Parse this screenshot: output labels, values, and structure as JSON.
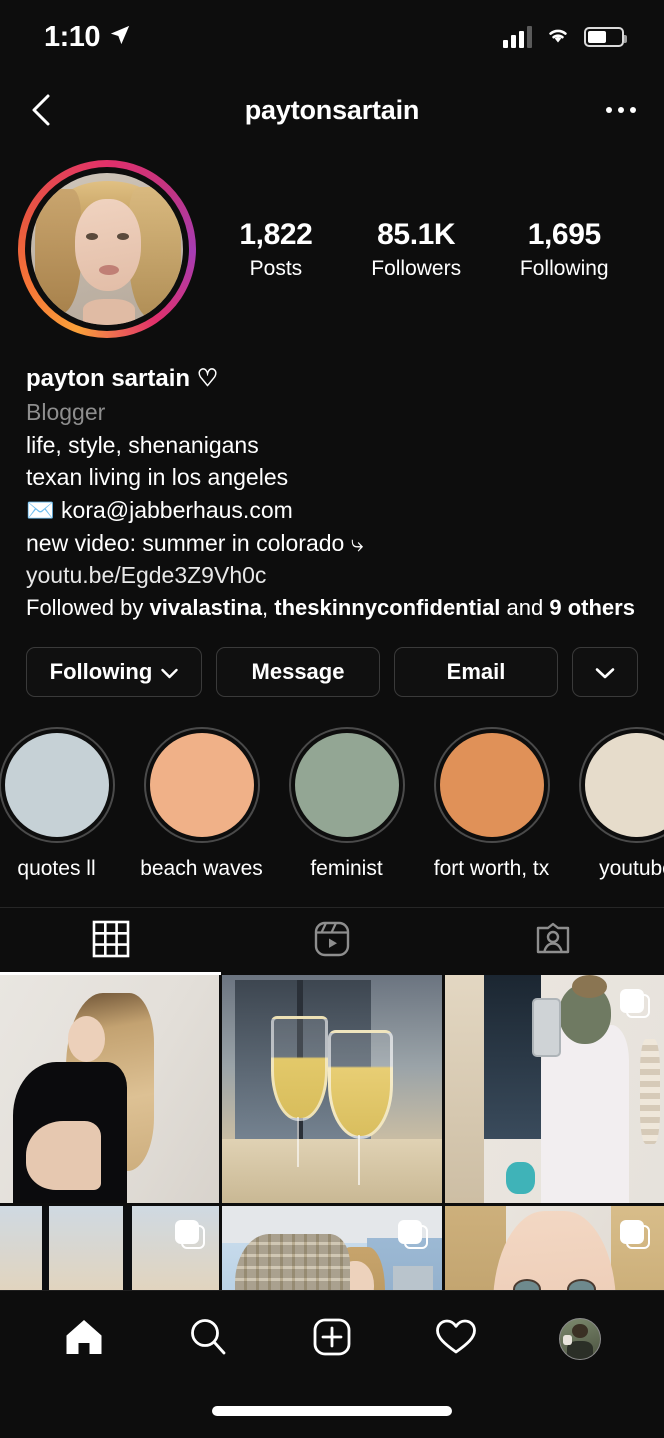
{
  "status_bar": {
    "time": "1:10",
    "location_icon": "location-arrow-icon",
    "cellular_icon": "cellular-bars-icon",
    "wifi_icon": "wifi-icon",
    "battery_icon": "battery-icon",
    "battery_level_percent": 55
  },
  "header": {
    "back_icon": "back-chevron-icon",
    "username": "paytonsartain",
    "more_icon": "ellipsis-icon"
  },
  "profile": {
    "avatar_has_story_ring": true,
    "story_ring_colors": [
      "#f9a03a",
      "#e1306c",
      "#c13584"
    ],
    "stats": [
      {
        "number": "1,822",
        "label": "Posts"
      },
      {
        "number": "85.1K",
        "label": "Followers"
      },
      {
        "number": "1,695",
        "label": "Following"
      }
    ],
    "display_name": "payton sartain ♡",
    "category": "Blogger",
    "bio_lines": [
      "life, style, shenanigans",
      "texan living in los angeles"
    ],
    "email_line": "✉️  kora@jabberhaus.com",
    "video_line": "new video: summer in colorado ⤷",
    "link": "youtu.be/Egde3Z9Vh0c",
    "followed_by_prefix": "Followed by ",
    "followed_by_names": [
      "vivalastina",
      "theskinnyconfidential"
    ],
    "followed_by_suffix_prefix": " and ",
    "followed_by_count": "9 others"
  },
  "actions": {
    "following_label": "Following",
    "following_chevron": "chevron-down-icon",
    "message_label": "Message",
    "email_label": "Email",
    "more_chevron": "chevron-down-icon"
  },
  "highlights": [
    {
      "label": "quotes ll",
      "color": "#c6d1d6"
    },
    {
      "label": "beach waves",
      "color": "#f0b188"
    },
    {
      "label": "feminist",
      "color": "#93a694"
    },
    {
      "label": "fort worth, tx",
      "color": "#e09158"
    },
    {
      "label": "youtube",
      "color": "#e6dccb"
    }
  ],
  "tabs": [
    {
      "name": "grid-tab",
      "icon": "grid-icon",
      "active": true
    },
    {
      "name": "reels-tab",
      "icon": "reels-icon",
      "active": false
    },
    {
      "name": "tagged-tab",
      "icon": "tagged-person-icon",
      "active": false
    }
  ],
  "grid_posts": [
    {
      "alt": "woman in black dress against cream wall",
      "carousel": false
    },
    {
      "alt": "two glasses of white wine on windowsill",
      "carousel": false
    },
    {
      "alt": "mirror selfie with green face mask",
      "carousel": true
    },
    {
      "alt": "sunset city view through window",
      "carousel": true
    },
    {
      "alt": "woman in plaid jacket by window",
      "carousel": true
    },
    {
      "alt": "close-up portrait of blonde woman",
      "carousel": true
    }
  ],
  "bottom_nav": [
    {
      "name": "home-nav-item",
      "icon": "home-icon",
      "active": true
    },
    {
      "name": "search-nav-item",
      "icon": "search-icon",
      "active": false
    },
    {
      "name": "create-nav-item",
      "icon": "plus-square-icon",
      "active": false
    },
    {
      "name": "activity-nav-item",
      "icon": "heart-icon",
      "active": false
    },
    {
      "name": "profile-nav-item",
      "icon": "profile-avatar-icon",
      "active": false
    }
  ]
}
